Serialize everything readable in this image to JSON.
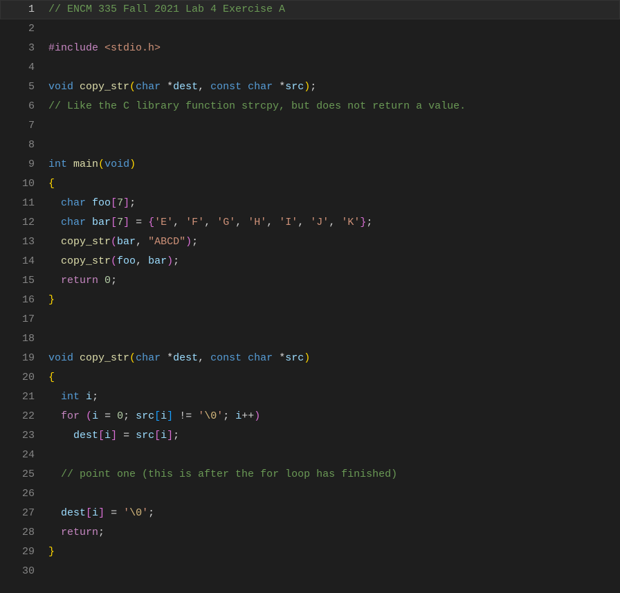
{
  "lines": [
    {
      "n": 1,
      "active": true,
      "tokens": [
        {
          "c": "tok-comment",
          "t": "// ENCM 335 Fall 2021 Lab 4 Exercise A"
        }
      ]
    },
    {
      "n": 2,
      "tokens": []
    },
    {
      "n": 3,
      "tokens": [
        {
          "c": "tok-keyword-ctrl",
          "t": "#include"
        },
        {
          "c": "tok-punct",
          "t": " "
        },
        {
          "c": "tok-include-path",
          "t": "<stdio.h>"
        }
      ]
    },
    {
      "n": 4,
      "tokens": []
    },
    {
      "n": 5,
      "tokens": [
        {
          "c": "tok-type",
          "t": "void"
        },
        {
          "c": "tok-punct",
          "t": " "
        },
        {
          "c": "tok-func",
          "t": "copy_str"
        },
        {
          "c": "tok-paren-yellow",
          "t": "("
        },
        {
          "c": "tok-type",
          "t": "char"
        },
        {
          "c": "tok-punct",
          "t": " "
        },
        {
          "c": "tok-op",
          "t": "*"
        },
        {
          "c": "tok-var",
          "t": "dest"
        },
        {
          "c": "tok-punct",
          "t": ", "
        },
        {
          "c": "tok-type",
          "t": "const"
        },
        {
          "c": "tok-punct",
          "t": " "
        },
        {
          "c": "tok-type",
          "t": "char"
        },
        {
          "c": "tok-punct",
          "t": " "
        },
        {
          "c": "tok-op",
          "t": "*"
        },
        {
          "c": "tok-var",
          "t": "src"
        },
        {
          "c": "tok-paren-yellow",
          "t": ")"
        },
        {
          "c": "tok-punct",
          "t": ";"
        }
      ]
    },
    {
      "n": 6,
      "tokens": [
        {
          "c": "tok-comment",
          "t": "// Like the C library function strcpy, but does not return a value."
        }
      ]
    },
    {
      "n": 7,
      "tokens": []
    },
    {
      "n": 8,
      "tokens": []
    },
    {
      "n": 9,
      "tokens": [
        {
          "c": "tok-type",
          "t": "int"
        },
        {
          "c": "tok-punct",
          "t": " "
        },
        {
          "c": "tok-func",
          "t": "main"
        },
        {
          "c": "tok-paren-yellow",
          "t": "("
        },
        {
          "c": "tok-type",
          "t": "void"
        },
        {
          "c": "tok-paren-yellow",
          "t": ")"
        }
      ]
    },
    {
      "n": 10,
      "tokens": [
        {
          "c": "tok-paren-yellow",
          "t": "{"
        }
      ]
    },
    {
      "n": 11,
      "tokens": [
        {
          "c": "tok-punct",
          "t": "  "
        },
        {
          "c": "tok-type",
          "t": "char"
        },
        {
          "c": "tok-punct",
          "t": " "
        },
        {
          "c": "tok-var",
          "t": "foo"
        },
        {
          "c": "tok-paren-pink",
          "t": "["
        },
        {
          "c": "tok-number",
          "t": "7"
        },
        {
          "c": "tok-paren-pink",
          "t": "]"
        },
        {
          "c": "tok-punct",
          "t": ";"
        }
      ]
    },
    {
      "n": 12,
      "tokens": [
        {
          "c": "tok-punct",
          "t": "  "
        },
        {
          "c": "tok-type",
          "t": "char"
        },
        {
          "c": "tok-punct",
          "t": " "
        },
        {
          "c": "tok-var",
          "t": "bar"
        },
        {
          "c": "tok-paren-pink",
          "t": "["
        },
        {
          "c": "tok-number",
          "t": "7"
        },
        {
          "c": "tok-paren-pink",
          "t": "]"
        },
        {
          "c": "tok-punct",
          "t": " = "
        },
        {
          "c": "tok-paren-pink",
          "t": "{"
        },
        {
          "c": "tok-string",
          "t": "'E'"
        },
        {
          "c": "tok-punct",
          "t": ", "
        },
        {
          "c": "tok-string",
          "t": "'F'"
        },
        {
          "c": "tok-punct",
          "t": ", "
        },
        {
          "c": "tok-string",
          "t": "'G'"
        },
        {
          "c": "tok-punct",
          "t": ", "
        },
        {
          "c": "tok-string",
          "t": "'H'"
        },
        {
          "c": "tok-punct",
          "t": ", "
        },
        {
          "c": "tok-string",
          "t": "'I'"
        },
        {
          "c": "tok-punct",
          "t": ", "
        },
        {
          "c": "tok-string",
          "t": "'J'"
        },
        {
          "c": "tok-punct",
          "t": ", "
        },
        {
          "c": "tok-string",
          "t": "'K'"
        },
        {
          "c": "tok-paren-pink",
          "t": "}"
        },
        {
          "c": "tok-punct",
          "t": ";"
        }
      ]
    },
    {
      "n": 13,
      "tokens": [
        {
          "c": "tok-punct",
          "t": "  "
        },
        {
          "c": "tok-func",
          "t": "copy_str"
        },
        {
          "c": "tok-paren-pink",
          "t": "("
        },
        {
          "c": "tok-var",
          "t": "bar"
        },
        {
          "c": "tok-punct",
          "t": ", "
        },
        {
          "c": "tok-string",
          "t": "\"ABCD\""
        },
        {
          "c": "tok-paren-pink",
          "t": ")"
        },
        {
          "c": "tok-punct",
          "t": ";"
        }
      ]
    },
    {
      "n": 14,
      "tokens": [
        {
          "c": "tok-punct",
          "t": "  "
        },
        {
          "c": "tok-func",
          "t": "copy_str"
        },
        {
          "c": "tok-paren-pink",
          "t": "("
        },
        {
          "c": "tok-var",
          "t": "foo"
        },
        {
          "c": "tok-punct",
          "t": ", "
        },
        {
          "c": "tok-var",
          "t": "bar"
        },
        {
          "c": "tok-paren-pink",
          "t": ")"
        },
        {
          "c": "tok-punct",
          "t": ";"
        }
      ]
    },
    {
      "n": 15,
      "tokens": [
        {
          "c": "tok-punct",
          "t": "  "
        },
        {
          "c": "tok-keyword-ctrl",
          "t": "return"
        },
        {
          "c": "tok-punct",
          "t": " "
        },
        {
          "c": "tok-number",
          "t": "0"
        },
        {
          "c": "tok-punct",
          "t": ";"
        }
      ]
    },
    {
      "n": 16,
      "tokens": [
        {
          "c": "tok-paren-yellow",
          "t": "}"
        }
      ]
    },
    {
      "n": 17,
      "tokens": []
    },
    {
      "n": 18,
      "tokens": []
    },
    {
      "n": 19,
      "tokens": [
        {
          "c": "tok-type",
          "t": "void"
        },
        {
          "c": "tok-punct",
          "t": " "
        },
        {
          "c": "tok-func",
          "t": "copy_str"
        },
        {
          "c": "tok-paren-yellow",
          "t": "("
        },
        {
          "c": "tok-type",
          "t": "char"
        },
        {
          "c": "tok-punct",
          "t": " "
        },
        {
          "c": "tok-op",
          "t": "*"
        },
        {
          "c": "tok-var",
          "t": "dest"
        },
        {
          "c": "tok-punct",
          "t": ", "
        },
        {
          "c": "tok-type",
          "t": "const"
        },
        {
          "c": "tok-punct",
          "t": " "
        },
        {
          "c": "tok-type",
          "t": "char"
        },
        {
          "c": "tok-punct",
          "t": " "
        },
        {
          "c": "tok-op",
          "t": "*"
        },
        {
          "c": "tok-var",
          "t": "src"
        },
        {
          "c": "tok-paren-yellow",
          "t": ")"
        }
      ]
    },
    {
      "n": 20,
      "tokens": [
        {
          "c": "tok-paren-yellow",
          "t": "{"
        }
      ]
    },
    {
      "n": 21,
      "tokens": [
        {
          "c": "tok-punct",
          "t": "  "
        },
        {
          "c": "tok-type",
          "t": "int"
        },
        {
          "c": "tok-punct",
          "t": " "
        },
        {
          "c": "tok-var",
          "t": "i"
        },
        {
          "c": "tok-punct",
          "t": ";"
        }
      ]
    },
    {
      "n": 22,
      "tokens": [
        {
          "c": "tok-punct",
          "t": "  "
        },
        {
          "c": "tok-keyword-ctrl",
          "t": "for"
        },
        {
          "c": "tok-punct",
          "t": " "
        },
        {
          "c": "tok-paren-pink",
          "t": "("
        },
        {
          "c": "tok-var",
          "t": "i"
        },
        {
          "c": "tok-punct",
          "t": " = "
        },
        {
          "c": "tok-number",
          "t": "0"
        },
        {
          "c": "tok-punct",
          "t": "; "
        },
        {
          "c": "tok-var",
          "t": "src"
        },
        {
          "c": "tok-paren-blue",
          "t": "["
        },
        {
          "c": "tok-var",
          "t": "i"
        },
        {
          "c": "tok-paren-blue",
          "t": "]"
        },
        {
          "c": "tok-punct",
          "t": " != "
        },
        {
          "c": "tok-string",
          "t": "'"
        },
        {
          "c": "tok-escape",
          "t": "\\0"
        },
        {
          "c": "tok-string",
          "t": "'"
        },
        {
          "c": "tok-punct",
          "t": "; "
        },
        {
          "c": "tok-var",
          "t": "i"
        },
        {
          "c": "tok-punct",
          "t": "++"
        },
        {
          "c": "tok-paren-pink",
          "t": ")"
        }
      ]
    },
    {
      "n": 23,
      "tokens": [
        {
          "c": "tok-punct",
          "t": "    "
        },
        {
          "c": "tok-var",
          "t": "dest"
        },
        {
          "c": "tok-paren-pink",
          "t": "["
        },
        {
          "c": "tok-var",
          "t": "i"
        },
        {
          "c": "tok-paren-pink",
          "t": "]"
        },
        {
          "c": "tok-punct",
          "t": " = "
        },
        {
          "c": "tok-var",
          "t": "src"
        },
        {
          "c": "tok-paren-pink",
          "t": "["
        },
        {
          "c": "tok-var",
          "t": "i"
        },
        {
          "c": "tok-paren-pink",
          "t": "]"
        },
        {
          "c": "tok-punct",
          "t": ";"
        }
      ]
    },
    {
      "n": 24,
      "tokens": []
    },
    {
      "n": 25,
      "tokens": [
        {
          "c": "tok-punct",
          "t": "  "
        },
        {
          "c": "tok-comment",
          "t": "// point one (this is after the for loop has finished)"
        }
      ]
    },
    {
      "n": 26,
      "tokens": []
    },
    {
      "n": 27,
      "tokens": [
        {
          "c": "tok-punct",
          "t": "  "
        },
        {
          "c": "tok-var",
          "t": "dest"
        },
        {
          "c": "tok-paren-pink",
          "t": "["
        },
        {
          "c": "tok-var",
          "t": "i"
        },
        {
          "c": "tok-paren-pink",
          "t": "]"
        },
        {
          "c": "tok-punct",
          "t": " = "
        },
        {
          "c": "tok-string",
          "t": "'"
        },
        {
          "c": "tok-escape",
          "t": "\\0"
        },
        {
          "c": "tok-string",
          "t": "'"
        },
        {
          "c": "tok-punct",
          "t": ";"
        }
      ]
    },
    {
      "n": 28,
      "tokens": [
        {
          "c": "tok-punct",
          "t": "  "
        },
        {
          "c": "tok-keyword-ctrl",
          "t": "return"
        },
        {
          "c": "tok-punct",
          "t": ";"
        }
      ]
    },
    {
      "n": 29,
      "tokens": [
        {
          "c": "tok-paren-yellow",
          "t": "}"
        }
      ]
    },
    {
      "n": 30,
      "tokens": []
    }
  ]
}
